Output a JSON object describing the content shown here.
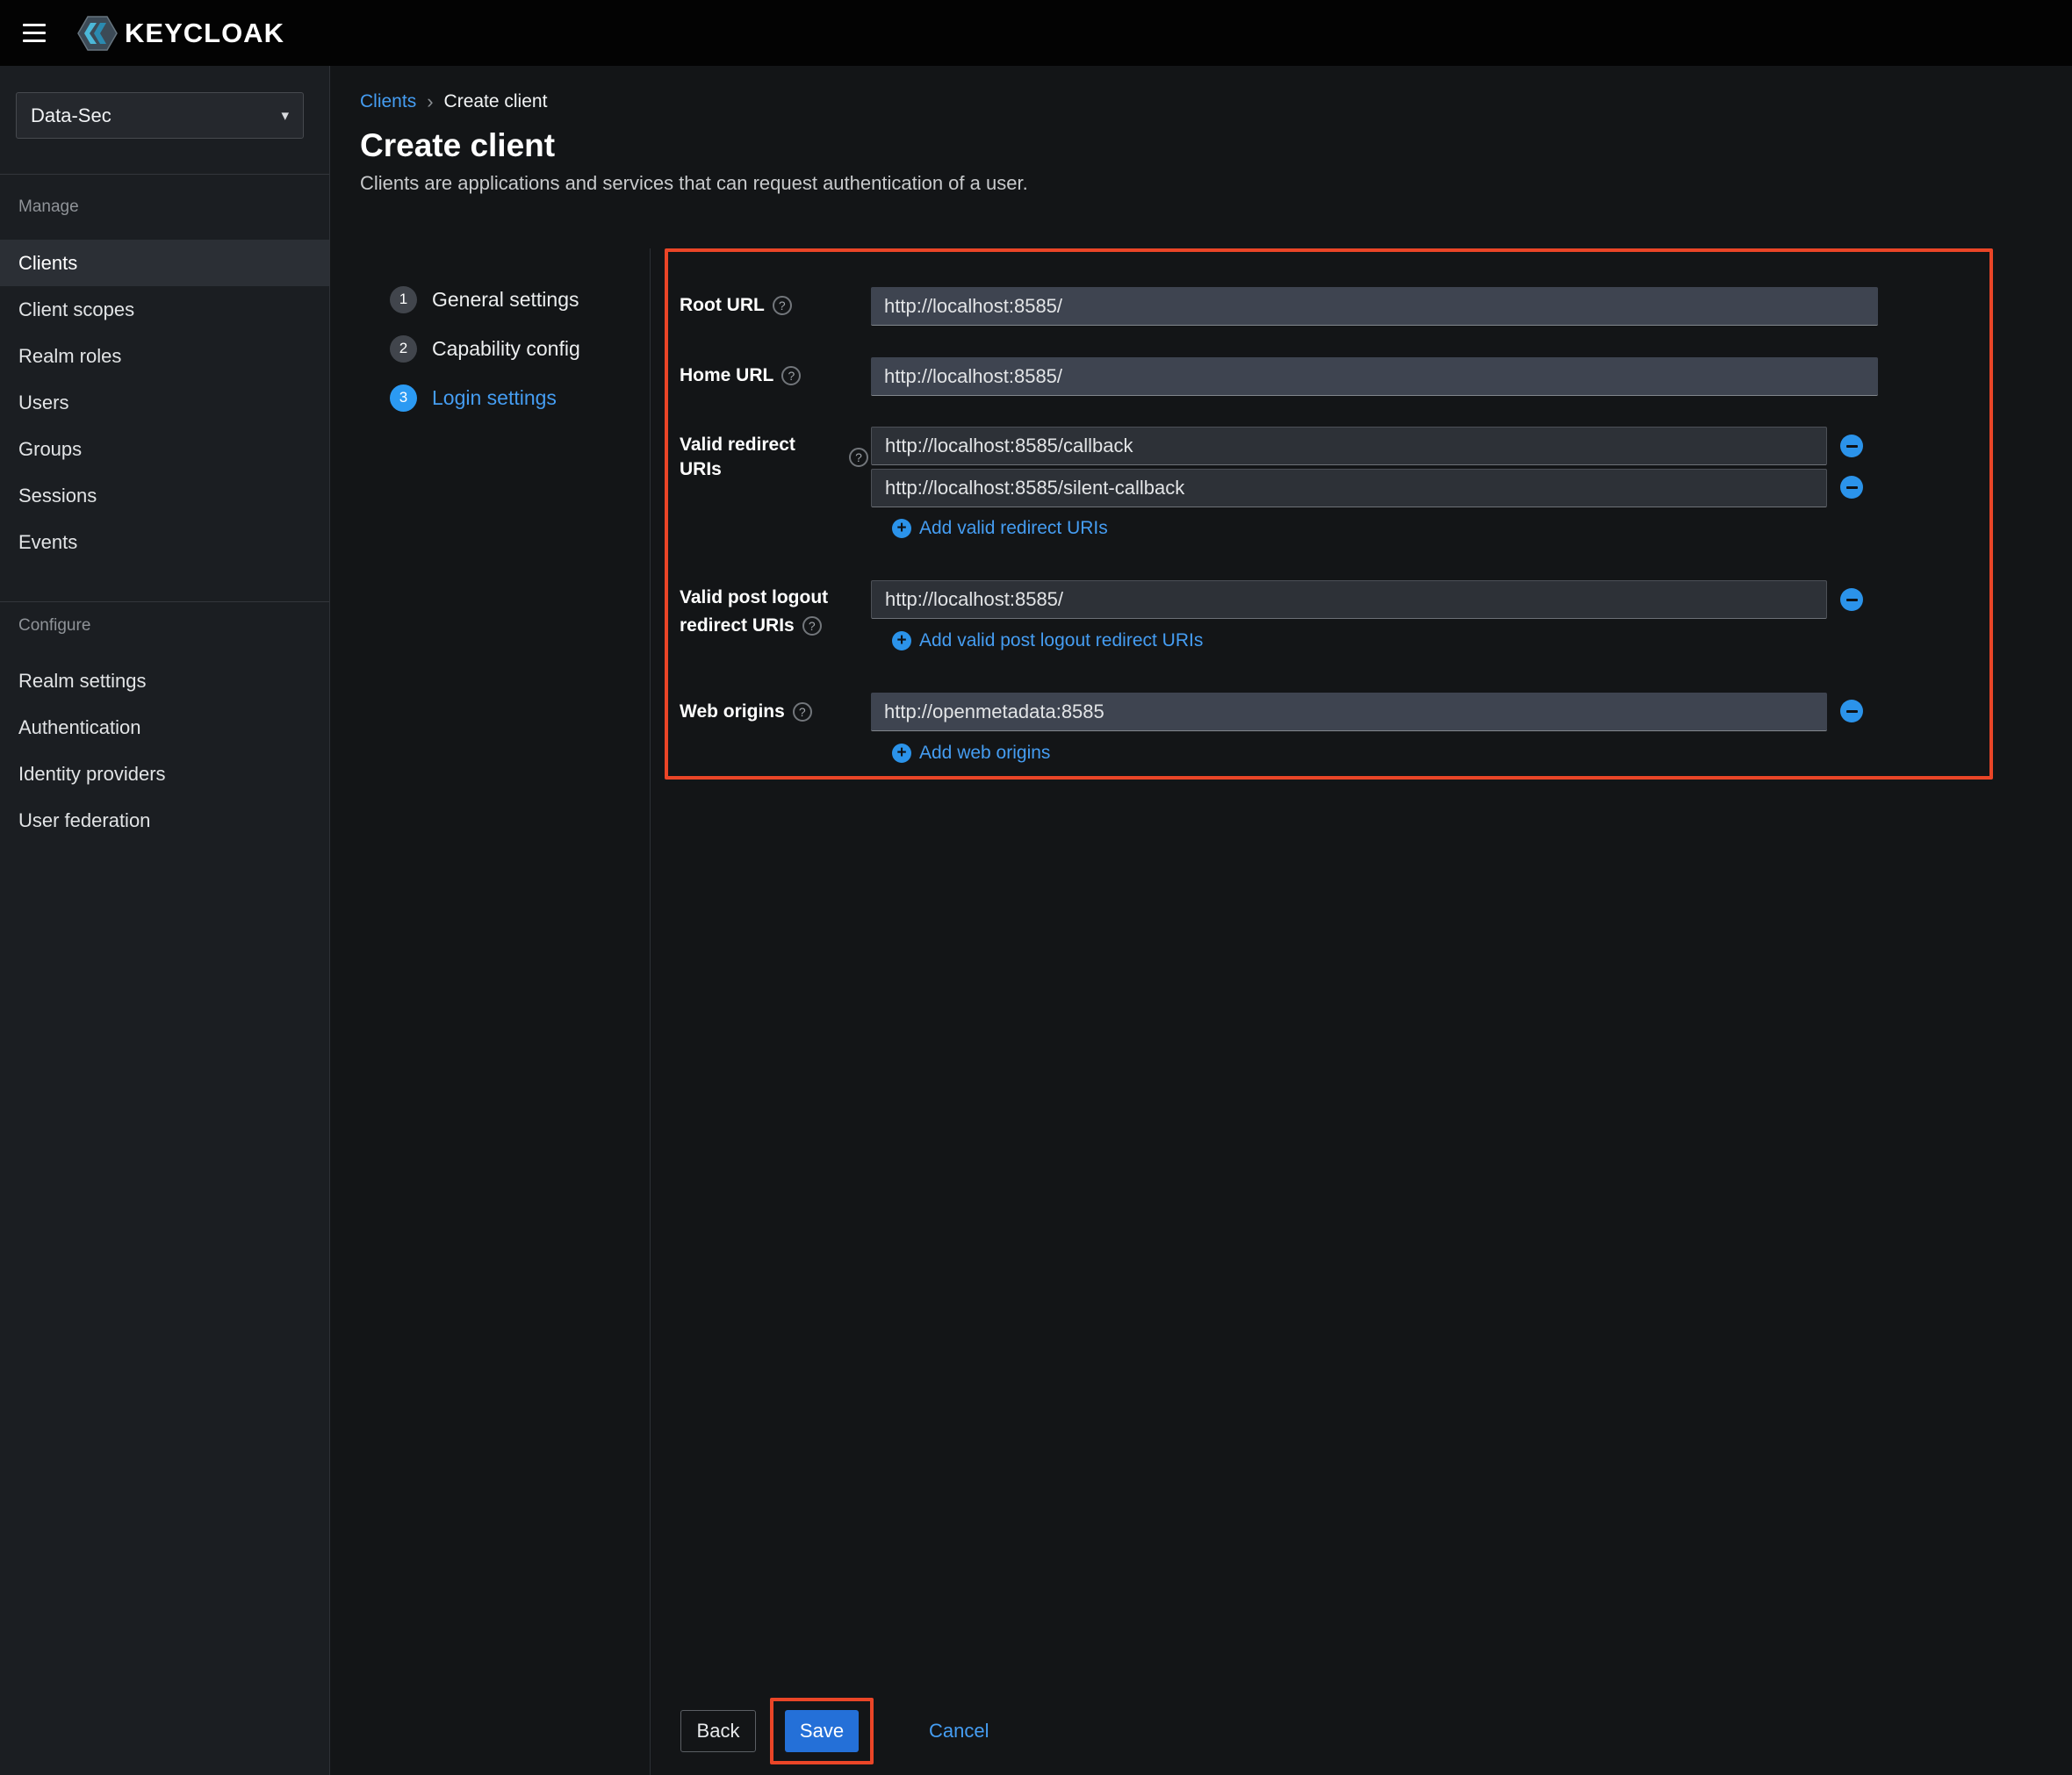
{
  "topbar": {
    "brand": "KEYCLOAK"
  },
  "sidebar": {
    "realm_selector": {
      "value": "Data-Sec"
    },
    "manage": {
      "label": "Manage",
      "items": [
        {
          "label": "Clients"
        },
        {
          "label": "Client scopes"
        },
        {
          "label": "Realm roles"
        },
        {
          "label": "Users"
        },
        {
          "label": "Groups"
        },
        {
          "label": "Sessions"
        },
        {
          "label": "Events"
        }
      ]
    },
    "configure": {
      "label": "Configure",
      "items": [
        {
          "label": "Realm settings"
        },
        {
          "label": "Authentication"
        },
        {
          "label": "Identity providers"
        },
        {
          "label": "User federation"
        }
      ]
    }
  },
  "breadcrumb": {
    "parent": "Clients",
    "separator": "›",
    "current": "Create client"
  },
  "page": {
    "title": "Create client",
    "subtitle": "Clients are applications and services that can request authentication of a user."
  },
  "wizard": {
    "steps": [
      {
        "number": "1",
        "label": "General settings"
      },
      {
        "number": "2",
        "label": "Capability config"
      },
      {
        "number": "3",
        "label": "Login settings"
      }
    ]
  },
  "form": {
    "root_url": {
      "label": "Root URL",
      "value": "http://localhost:8585/"
    },
    "home_url": {
      "label": "Home URL",
      "value": "http://localhost:8585/"
    },
    "redirect_uris": {
      "label": "Valid redirect URIs",
      "values": [
        "http://localhost:8585/callback",
        "http://localhost:8585/silent-callback"
      ],
      "add_label": "Add valid redirect URIs"
    },
    "post_logout": {
      "label_line1": "Valid post logout",
      "label_line2": "redirect URIs",
      "value": "http://localhost:8585/",
      "add_label": "Add valid post logout redirect URIs"
    },
    "web_origins": {
      "label": "Web origins",
      "value": "http://openmetadata:8585",
      "add_label": "Add web origins"
    }
  },
  "footer": {
    "back": "Back",
    "save": "Save",
    "cancel": "Cancel"
  },
  "icons": {
    "help": "?",
    "caret": "▾",
    "plus": "+"
  },
  "colors": {
    "accent_blue": "#459df2",
    "primary_button": "#2470d8",
    "annotation_orange": "#ea4527"
  }
}
